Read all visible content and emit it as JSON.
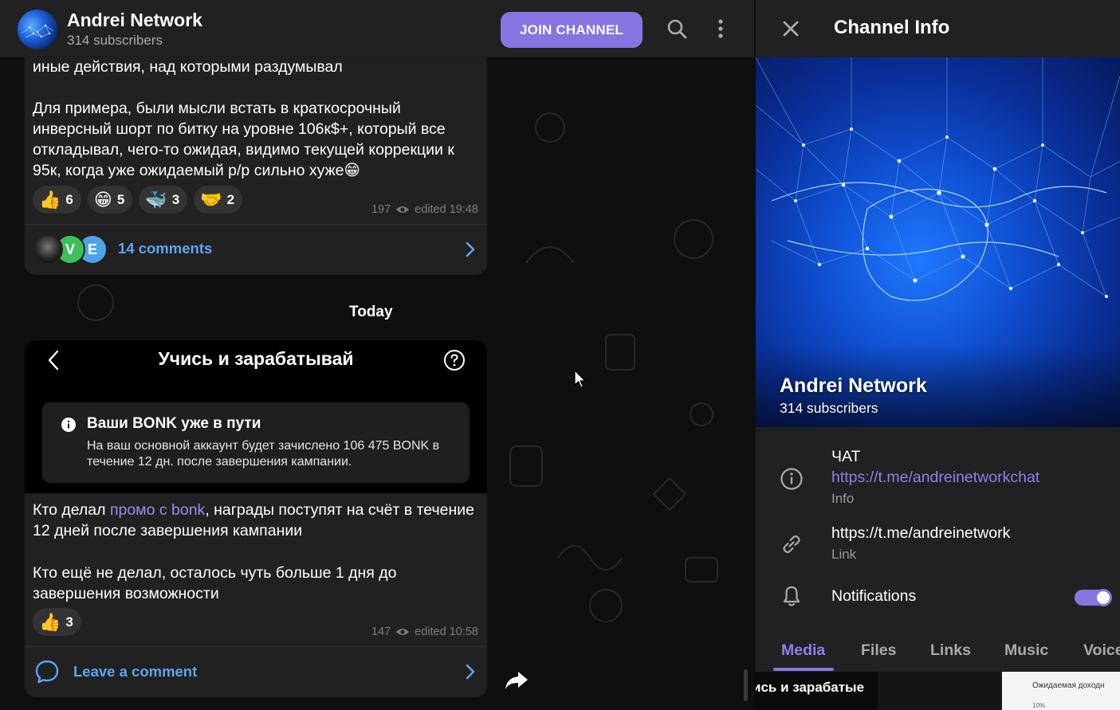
{
  "chat_header": {
    "title": "Andrei Network",
    "subtitle": "314 subscribers",
    "join_label": "JOIN CHANNEL"
  },
  "post1": {
    "text_line0": "иные действия, над которыми раздумывал",
    "text_para": "Для примера, были мысли встать в краткосрочный инверсный шорт по битку на уровне 106к$+, который все откладывал, чего-то ожидая, видимо текущей коррекции к 95к, когда уже ожидаемый р/р сильно хуже😁",
    "reactions": [
      {
        "emoji": "👍",
        "count": "6"
      },
      {
        "emoji": "😁",
        "count": "5"
      },
      {
        "emoji": "🐳",
        "count": "3"
      },
      {
        "emoji": "🤝",
        "count": "2"
      }
    ],
    "views": "197",
    "edited": "edited 19:48",
    "comments_label": "14 comments",
    "commenter_initials": [
      "V",
      "E"
    ]
  },
  "date_separator": "Today",
  "post2": {
    "embed_title": "Учись и зарабатывай",
    "embed_card_title": "Ваши BONK уже в пути",
    "embed_card_body": "На ваш основной аккаунт будет зачислено 106 475 BONK в течение 12 дн. после завершения кампании.",
    "text_before_link": "Кто делал ",
    "link_text": "промо с bonk",
    "text_after_link": ", награды поступят на счёт в течение 12 дней после завершения кампании",
    "text_para2": "Кто ещё не делал, осталось чуть больше 1 дня до завершения возможности",
    "reactions": [
      {
        "emoji": "👍",
        "count": "3"
      }
    ],
    "views": "147",
    "edited": "edited 10:58",
    "comment_label": "Leave a comment"
  },
  "panel": {
    "title": "Channel Info",
    "channel_name": "Andrei Network",
    "subscribers": "314 subscribers",
    "info_heading": "ЧАТ",
    "info_link": "https://t.me/andreinetworkchat",
    "info_label": "Info",
    "link_value": "https://t.me/andreinetwork",
    "link_label": "Link",
    "notifications_label": "Notifications",
    "notifications_on": true,
    "tabs": [
      "Media",
      "Files",
      "Links",
      "Music",
      "Voice"
    ],
    "active_tab": "Media",
    "media_thumb_text": "ись и зарабатые",
    "media_thumb3_text": "Ожидаемая доходн",
    "media_thumb3_small": "10%"
  },
  "colors": {
    "accent": "#8774e1",
    "link_blue": "#5ea4f0",
    "bubble": "#212121",
    "panel": "#212121"
  },
  "icons": [
    "search-icon",
    "more-vertical-icon",
    "close-icon",
    "info-icon",
    "link-icon",
    "bell-icon",
    "chevron-right-icon",
    "comment-icon",
    "share-icon",
    "eye-icon",
    "back-chevron-icon",
    "help-icon"
  ]
}
